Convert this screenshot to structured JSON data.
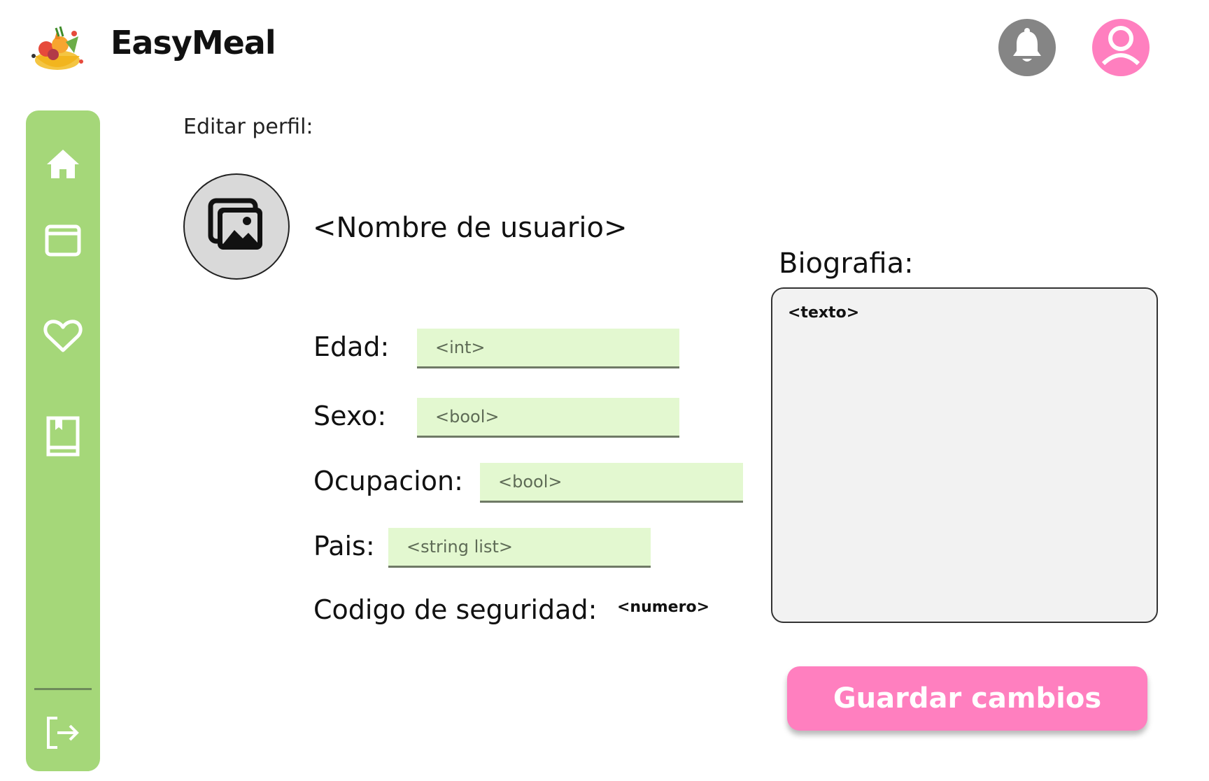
{
  "app": {
    "title": "EasyMeal",
    "logo": "fruit-bowl-logo"
  },
  "header": {
    "notifications_icon": "bell-icon",
    "profile_icon": "user-icon"
  },
  "sidebar": {
    "items": [
      {
        "id": "home",
        "icon": "home-icon"
      },
      {
        "id": "calendar",
        "icon": "calendar-icon"
      },
      {
        "id": "favorites",
        "icon": "heart-icon"
      },
      {
        "id": "recipes",
        "icon": "book-icon"
      }
    ],
    "logout_icon": "logout-icon"
  },
  "main": {
    "section_title": "Editar perfil:",
    "avatar_icon": "image-gallery-icon",
    "username": "<Nombre de usuario>",
    "fields": {
      "age": {
        "label": "Edad:",
        "placeholder": "<int>"
      },
      "sex": {
        "label": "Sexo:",
        "placeholder": "<bool>"
      },
      "occupation": {
        "label": "Ocupacion:",
        "placeholder": "<bool>"
      },
      "country": {
        "label": "Pais:",
        "placeholder": "<string list>"
      }
    },
    "security_code": {
      "label": "Codigo de seguridad:",
      "value": "<numero>"
    },
    "bio": {
      "label": "Biografia:",
      "placeholder": "<texto>"
    },
    "save_label": "Guardar cambios"
  },
  "colors": {
    "sidebar": "#a5d779",
    "accent_pink": "#ff7fbf",
    "input_bg": "#e3f8d0",
    "bell_bg": "#858585"
  }
}
